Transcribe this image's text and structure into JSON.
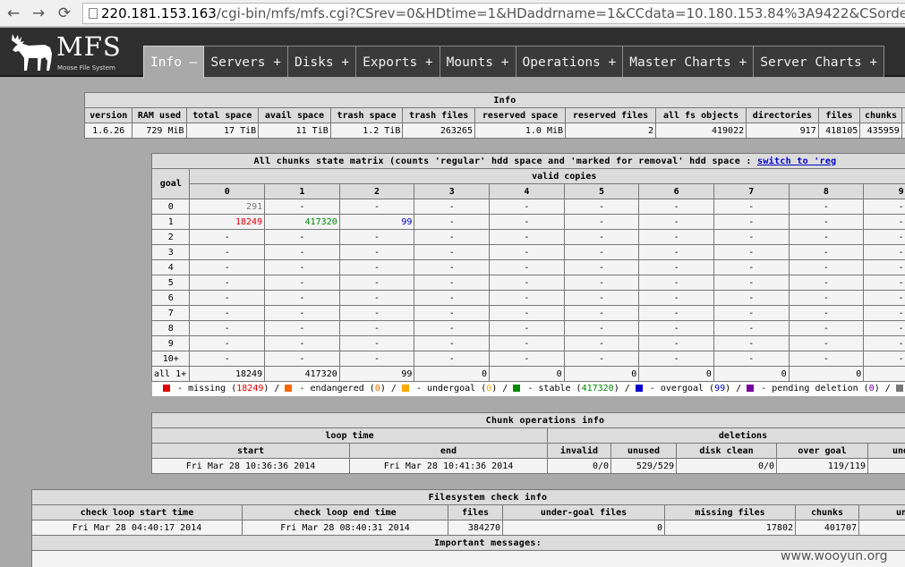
{
  "browser": {
    "back_icon": "←",
    "forward_icon": "→",
    "reload_icon": "⟳",
    "url_host": "220.181.153.163",
    "url_rest": "/cgi-bin/mfs/mfs.cgi?CSrev=0&HDtime=1&HDaddrname=1&CCdata=10.180.153.84%3A9422&CSorder"
  },
  "logo": {
    "title": "MFS",
    "subtitle": "Moose File System"
  },
  "tabs": [
    "Info –",
    "Servers +",
    "Disks +",
    "Exports +",
    "Mounts +",
    "Operations +",
    "Master Charts +",
    "Server Charts +"
  ],
  "info": {
    "title": "Info",
    "headers": [
      "version",
      "RAM used",
      "total space",
      "avail space",
      "trash space",
      "trash files",
      "reserved space",
      "reserved files",
      "all fs objects",
      "directories",
      "files",
      "chunks",
      "all"
    ],
    "values": [
      "1.6.26",
      "729 MiB",
      "17 TiB",
      "11 TiB",
      "1.2 TiB",
      "263265",
      "1.0 MiB",
      "2",
      "419022",
      "917",
      "418105",
      "435959",
      ""
    ]
  },
  "matrix": {
    "title_prefix": "All chunks state matrix (counts 'regular' hdd space and 'marked for removal' hdd space : ",
    "switch_link": "switch to 'reg",
    "goal_label": "goal",
    "valid_copies_label": "valid copies",
    "columns": [
      "0",
      "1",
      "2",
      "3",
      "4",
      "5",
      "6",
      "7",
      "8",
      "9"
    ],
    "rows": [
      {
        "goal": "0",
        "cells": [
          "291",
          "-",
          "-",
          "-",
          "-",
          "-",
          "-",
          "-",
          "-",
          "-"
        ]
      },
      {
        "goal": "1",
        "cells": [
          "18249",
          "417320",
          "99",
          "-",
          "-",
          "-",
          "-",
          "-",
          "-",
          "-"
        ]
      },
      {
        "goal": "2",
        "cells": [
          "-",
          "-",
          "-",
          "-",
          "-",
          "-",
          "-",
          "-",
          "-",
          "-"
        ]
      },
      {
        "goal": "3",
        "cells": [
          "-",
          "-",
          "-",
          "-",
          "-",
          "-",
          "-",
          "-",
          "-",
          "-"
        ]
      },
      {
        "goal": "4",
        "cells": [
          "-",
          "-",
          "-",
          "-",
          "-",
          "-",
          "-",
          "-",
          "-",
          "-"
        ]
      },
      {
        "goal": "5",
        "cells": [
          "-",
          "-",
          "-",
          "-",
          "-",
          "-",
          "-",
          "-",
          "-",
          "-"
        ]
      },
      {
        "goal": "6",
        "cells": [
          "-",
          "-",
          "-",
          "-",
          "-",
          "-",
          "-",
          "-",
          "-",
          "-"
        ]
      },
      {
        "goal": "7",
        "cells": [
          "-",
          "-",
          "-",
          "-",
          "-",
          "-",
          "-",
          "-",
          "-",
          "-"
        ]
      },
      {
        "goal": "8",
        "cells": [
          "-",
          "-",
          "-",
          "-",
          "-",
          "-",
          "-",
          "-",
          "-",
          "-"
        ]
      },
      {
        "goal": "9",
        "cells": [
          "-",
          "-",
          "-",
          "-",
          "-",
          "-",
          "-",
          "-",
          "-",
          "-"
        ]
      },
      {
        "goal": "10+",
        "cells": [
          "-",
          "-",
          "-",
          "-",
          "-",
          "-",
          "-",
          "-",
          "-",
          "-"
        ]
      },
      {
        "goal": "all 1+",
        "cells": [
          "18249",
          "417320",
          "99",
          "0",
          "0",
          "0",
          "0",
          "0",
          "0",
          "0"
        ]
      }
    ],
    "cell_colors": {
      "missing": "#e00000",
      "stable": "#008800",
      "overgoal": "#0000cc",
      "zero_goal": "#777777"
    }
  },
  "legend": {
    "items": [
      {
        "color": "#e00000",
        "label": "missing",
        "count": "18249"
      },
      {
        "color": "#ff6600",
        "label": "endangered",
        "count": "0"
      },
      {
        "color": "#ffaa00",
        "label": "undergoal",
        "count": "0"
      },
      {
        "color": "#008800",
        "label": "stable",
        "count": "417320"
      },
      {
        "color": "#0000cc",
        "label": "overgoal",
        "count": "99"
      },
      {
        "color": "#770099",
        "label": "pending deletion",
        "count": "0"
      },
      {
        "color": "#777777",
        "label": "",
        "count": ""
      }
    ]
  },
  "chunkops": {
    "title": "Chunk operations info",
    "loop_time": "loop time",
    "deletions": "deletions",
    "start": "start",
    "end": "end",
    "invalid": "invalid",
    "unused": "unused",
    "disk_clean": "disk clean",
    "over_goal": "over goal",
    "under": "unde",
    "v_start": "Fri Mar 28 10:36:36 2014",
    "v_end": "Fri Mar 28 10:41:36 2014",
    "v_invalid": "0/0",
    "v_unused": "529/529",
    "v_disk_clean": "0/0",
    "v_over_goal": "119/119"
  },
  "fscheck": {
    "title": "Filesystem check info",
    "headers": [
      "check loop start time",
      "check loop end time",
      "files",
      "under-goal files",
      "missing files",
      "chunks",
      "un"
    ],
    "values": [
      "Fri Mar 28 04:40:17 2014",
      "Fri Mar 28 08:40:31 2014",
      "384270",
      "0",
      "17802",
      "401707",
      ""
    ],
    "important": "Important messages:"
  },
  "watermark": "www.wooyun.org"
}
